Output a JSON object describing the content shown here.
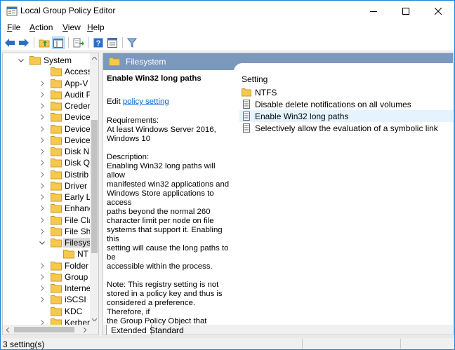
{
  "window": {
    "title": "Local Group Policy Editor"
  },
  "menu": [
    {
      "label": "File"
    },
    {
      "label": "Action"
    },
    {
      "label": "View"
    },
    {
      "label": "Help"
    }
  ],
  "toolbar": {
    "icons": [
      "back-icon",
      "forward-icon",
      "up-folder-icon",
      "show-hide-tree-icon",
      "export-list-icon",
      "help-icon",
      "properties-icon",
      "filter-icon"
    ]
  },
  "tree": {
    "items": [
      {
        "label": "System",
        "expanded": true
      },
      {
        "label": "Access"
      },
      {
        "label": "App-V"
      },
      {
        "label": "Audit P"
      },
      {
        "label": "Creder"
      },
      {
        "label": "Device"
      },
      {
        "label": "Device"
      },
      {
        "label": "Device"
      },
      {
        "label": "Disk N"
      },
      {
        "label": "Disk Q"
      },
      {
        "label": "Distrib"
      },
      {
        "label": "Driver"
      },
      {
        "label": "Early L"
      },
      {
        "label": "Enhanc"
      },
      {
        "label": "File Cla"
      },
      {
        "label": "File Sh"
      },
      {
        "label": "Filesys",
        "selected": true,
        "expanded": true
      },
      {
        "label": "NT"
      },
      {
        "label": "Folder"
      },
      {
        "label": "Group"
      },
      {
        "label": "Interne"
      },
      {
        "label": "iSCSI"
      },
      {
        "label": "KDC"
      },
      {
        "label": "Kerber"
      }
    ]
  },
  "right": {
    "header": "Filesystem",
    "description": {
      "title": "Enable Win32 long paths",
      "edit_prefix": "Edit",
      "edit_link": "policy setting",
      "requirements": "Requirements:\nAt least Windows Server 2016,\nWindows 10",
      "description": "Description:\nEnabling Win32 long paths will allow\nmanifested win32 applications and\nWindows Store applications to access\npaths beyond the normal 260\ncharacter limit per node on file\nsystems that support it.  Enabling this\nsetting will cause the long paths to be\naccessible within the process.",
      "note": "Note:  This registry setting is not\nstored in a policy key and thus is\nconsidered a preference.  Therefore, if\nthe Group Policy Object that\nimplements this setting is ever\nremoved, this registry setting will\nremain."
    },
    "setting_column": "Setting",
    "settings": [
      {
        "label": "NTFS",
        "icon": "folder-icon"
      },
      {
        "label": "Disable delete notifications on all volumes",
        "icon": "policy-setting-icon"
      },
      {
        "label": "Enable Win32 long paths",
        "icon": "policy-setting-icon",
        "selected": true
      },
      {
        "label": "Selectively allow the evaluation of a symbolic link",
        "icon": "policy-setting-icon"
      }
    ],
    "tabs": [
      {
        "label": "Extended",
        "active": true
      },
      {
        "label": "Standard",
        "active": false
      }
    ]
  },
  "status": {
    "text": "3 setting(s)"
  },
  "colors": {
    "header": "#7b98bd",
    "folder": "#f5c94e",
    "link": "#0066cc",
    "selected_row": "#e5f3ff"
  }
}
